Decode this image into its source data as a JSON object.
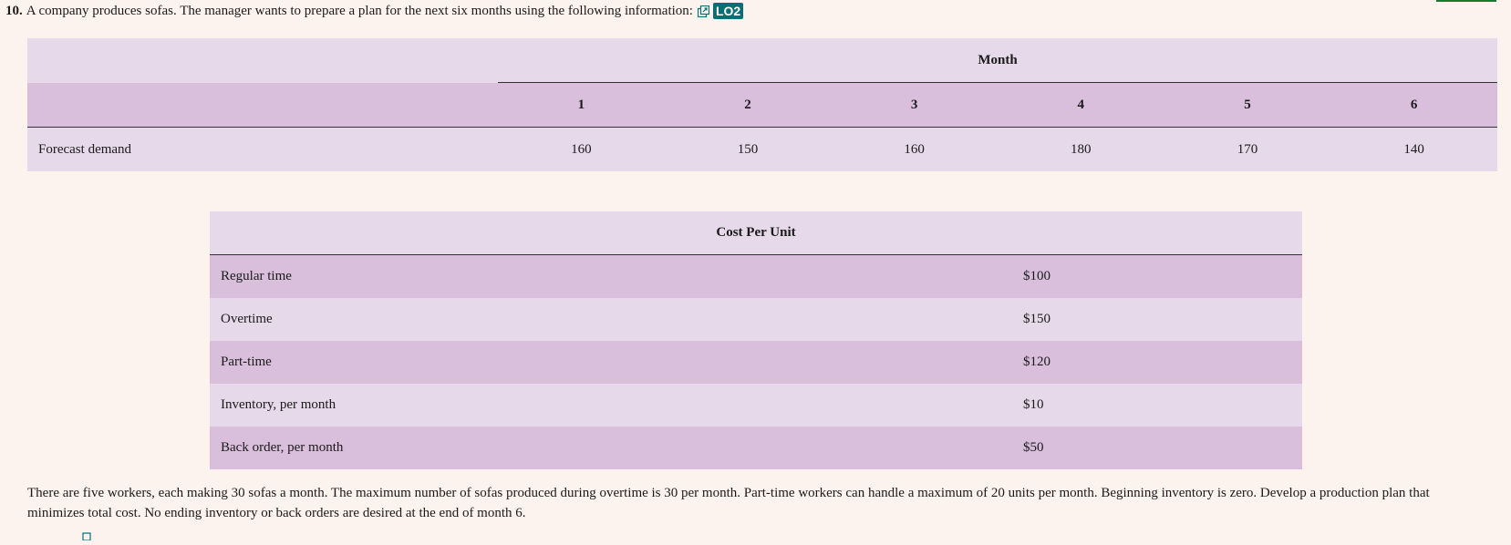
{
  "question": {
    "number": "10.",
    "text": "A company produces sofas. The manager wants to prepare a plan for the next six months using the following information:",
    "link_icon": "external-link-icon",
    "learning_objective": "LO2"
  },
  "demand_table": {
    "group_header": "Month",
    "months": [
      "1",
      "2",
      "3",
      "4",
      "5",
      "6"
    ],
    "row_label": "Forecast demand",
    "values": [
      "160",
      "150",
      "160",
      "180",
      "170",
      "140"
    ]
  },
  "cost_table": {
    "header": "Cost Per Unit",
    "rows": [
      {
        "label": "Regular time",
        "value": "$100"
      },
      {
        "label": "Overtime",
        "value": "$150"
      },
      {
        "label": "Part-time",
        "value": "$120"
      },
      {
        "label": "Inventory, per month",
        "value": "$10"
      },
      {
        "label": "Back order, per month",
        "value": "$50"
      }
    ]
  },
  "footer_text": "There are five workers, each making 30 sofas a month. The maximum number of sofas produced during overtime is 30 per month. Part-time workers can handle a maximum of 20 units per month. Beginning inventory is zero. Develop a production plan that minimizes total cost. No ending inventory or back orders are desired at the end of month 6.",
  "colors": {
    "background": "#fdf3ee",
    "row_light": "#e6d9ea",
    "row_dark": "#d9bfdc",
    "badge": "#0b6e77"
  }
}
